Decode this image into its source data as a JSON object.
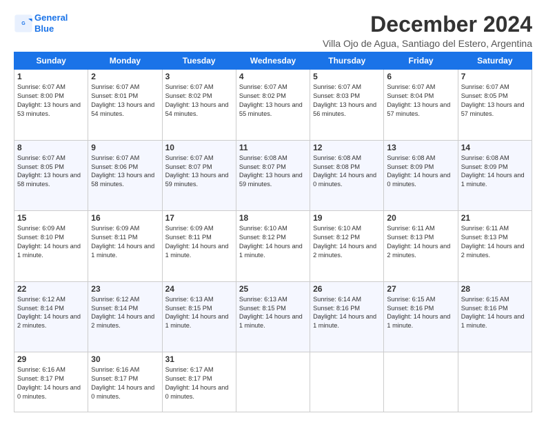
{
  "logo": {
    "line1": "General",
    "line2": "Blue"
  },
  "title": "December 2024",
  "location": "Villa Ojo de Agua, Santiago del Estero, Argentina",
  "weekdays": [
    "Sunday",
    "Monday",
    "Tuesday",
    "Wednesday",
    "Thursday",
    "Friday",
    "Saturday"
  ],
  "weeks": [
    [
      {
        "day": "1",
        "sunrise": "6:07 AM",
        "sunset": "8:00 PM",
        "daylight": "13 hours and 53 minutes."
      },
      {
        "day": "2",
        "sunrise": "6:07 AM",
        "sunset": "8:01 PM",
        "daylight": "13 hours and 54 minutes."
      },
      {
        "day": "3",
        "sunrise": "6:07 AM",
        "sunset": "8:02 PM",
        "daylight": "13 hours and 54 minutes."
      },
      {
        "day": "4",
        "sunrise": "6:07 AM",
        "sunset": "8:02 PM",
        "daylight": "13 hours and 55 minutes."
      },
      {
        "day": "5",
        "sunrise": "6:07 AM",
        "sunset": "8:03 PM",
        "daylight": "13 hours and 56 minutes."
      },
      {
        "day": "6",
        "sunrise": "6:07 AM",
        "sunset": "8:04 PM",
        "daylight": "13 hours and 57 minutes."
      },
      {
        "day": "7",
        "sunrise": "6:07 AM",
        "sunset": "8:05 PM",
        "daylight": "13 hours and 57 minutes."
      }
    ],
    [
      {
        "day": "8",
        "sunrise": "6:07 AM",
        "sunset": "8:05 PM",
        "daylight": "13 hours and 58 minutes."
      },
      {
        "day": "9",
        "sunrise": "6:07 AM",
        "sunset": "8:06 PM",
        "daylight": "13 hours and 58 minutes."
      },
      {
        "day": "10",
        "sunrise": "6:07 AM",
        "sunset": "8:07 PM",
        "daylight": "13 hours and 59 minutes."
      },
      {
        "day": "11",
        "sunrise": "6:08 AM",
        "sunset": "8:07 PM",
        "daylight": "13 hours and 59 minutes."
      },
      {
        "day": "12",
        "sunrise": "6:08 AM",
        "sunset": "8:08 PM",
        "daylight": "14 hours and 0 minutes."
      },
      {
        "day": "13",
        "sunrise": "6:08 AM",
        "sunset": "8:09 PM",
        "daylight": "14 hours and 0 minutes."
      },
      {
        "day": "14",
        "sunrise": "6:08 AM",
        "sunset": "8:09 PM",
        "daylight": "14 hours and 1 minute."
      }
    ],
    [
      {
        "day": "15",
        "sunrise": "6:09 AM",
        "sunset": "8:10 PM",
        "daylight": "14 hours and 1 minute."
      },
      {
        "day": "16",
        "sunrise": "6:09 AM",
        "sunset": "8:11 PM",
        "daylight": "14 hours and 1 minute."
      },
      {
        "day": "17",
        "sunrise": "6:09 AM",
        "sunset": "8:11 PM",
        "daylight": "14 hours and 1 minute."
      },
      {
        "day": "18",
        "sunrise": "6:10 AM",
        "sunset": "8:12 PM",
        "daylight": "14 hours and 1 minute."
      },
      {
        "day": "19",
        "sunrise": "6:10 AM",
        "sunset": "8:12 PM",
        "daylight": "14 hours and 2 minutes."
      },
      {
        "day": "20",
        "sunrise": "6:11 AM",
        "sunset": "8:13 PM",
        "daylight": "14 hours and 2 minutes."
      },
      {
        "day": "21",
        "sunrise": "6:11 AM",
        "sunset": "8:13 PM",
        "daylight": "14 hours and 2 minutes."
      }
    ],
    [
      {
        "day": "22",
        "sunrise": "6:12 AM",
        "sunset": "8:14 PM",
        "daylight": "14 hours and 2 minutes."
      },
      {
        "day": "23",
        "sunrise": "6:12 AM",
        "sunset": "8:14 PM",
        "daylight": "14 hours and 2 minutes."
      },
      {
        "day": "24",
        "sunrise": "6:13 AM",
        "sunset": "8:15 PM",
        "daylight": "14 hours and 1 minute."
      },
      {
        "day": "25",
        "sunrise": "6:13 AM",
        "sunset": "8:15 PM",
        "daylight": "14 hours and 1 minute."
      },
      {
        "day": "26",
        "sunrise": "6:14 AM",
        "sunset": "8:16 PM",
        "daylight": "14 hours and 1 minute."
      },
      {
        "day": "27",
        "sunrise": "6:15 AM",
        "sunset": "8:16 PM",
        "daylight": "14 hours and 1 minute."
      },
      {
        "day": "28",
        "sunrise": "6:15 AM",
        "sunset": "8:16 PM",
        "daylight": "14 hours and 1 minute."
      }
    ],
    [
      {
        "day": "29",
        "sunrise": "6:16 AM",
        "sunset": "8:17 PM",
        "daylight": "14 hours and 0 minutes."
      },
      {
        "day": "30",
        "sunrise": "6:16 AM",
        "sunset": "8:17 PM",
        "daylight": "14 hours and 0 minutes."
      },
      {
        "day": "31",
        "sunrise": "6:17 AM",
        "sunset": "8:17 PM",
        "daylight": "14 hours and 0 minutes."
      },
      null,
      null,
      null,
      null
    ]
  ]
}
